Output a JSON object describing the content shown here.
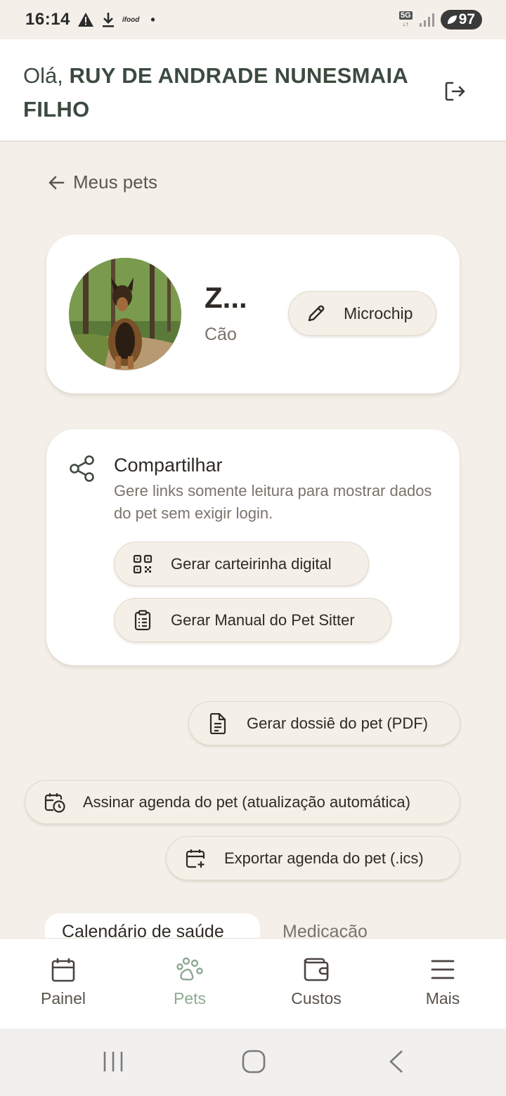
{
  "status_bar": {
    "time": "16:14",
    "app_label": "ifood",
    "dot": "•",
    "network": "5G",
    "battery": "97"
  },
  "header": {
    "greeting_prefix": "Olá,",
    "user_name": "RUY DE ANDRADE NUNESMAIA FILHO",
    "logout_icon": "logout-icon"
  },
  "back_link": {
    "label": "Meus pets"
  },
  "pet": {
    "name": "Z...",
    "species": "Cão",
    "microchip_label": "Microchip"
  },
  "share": {
    "title": "Compartilhar",
    "description": "Gere links somente leitura para mostrar dados do pet sem exigir login.",
    "carteirinha_label": "Gerar carteirinha digital",
    "manual_label": "Gerar Manual do Pet Sitter"
  },
  "actions": {
    "dossie_label": "Gerar dossiê do pet (PDF)",
    "assinar_label": "Assinar agenda do pet (atualização automática)",
    "exportar_label": "Exportar agenda do pet (.ics)"
  },
  "tabs": [
    {
      "label": "Calendário de saúde",
      "active": true
    },
    {
      "label": "Medicação",
      "active": false
    }
  ],
  "bottom_nav": [
    {
      "label": "Painel",
      "icon": "calendar-icon",
      "active": false
    },
    {
      "label": "Pets",
      "icon": "paw-icon",
      "active": true
    },
    {
      "label": "Custos",
      "icon": "wallet-icon",
      "active": false
    },
    {
      "label": "Mais",
      "icon": "menu-icon",
      "active": false
    }
  ],
  "colors": {
    "background": "#f4f0e9",
    "card": "#ffffff",
    "pill": "#f4efe7",
    "header_text": "#3c4a3f",
    "active_nav": "#8fa893"
  }
}
